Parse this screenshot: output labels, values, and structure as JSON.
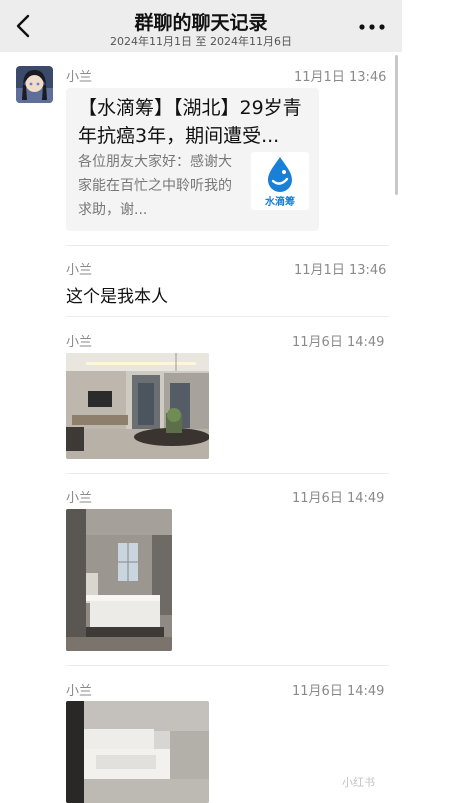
{
  "header": {
    "title": "群聊的聊天记录",
    "date_range": "2024年11月1日 至 2024年11月6日"
  },
  "messages": [
    {
      "sender": "小兰",
      "time": "11月1日 13:46",
      "card": {
        "title": "【水滴筹】【湖北】29岁青年抗癌3年，期间遭受...",
        "desc": "各位朋友大家好：感谢大家能在百忙之中聆听我的求助，谢...",
        "logo_text": "水滴筹"
      }
    },
    {
      "sender": "小兰",
      "time": "11月1日 13:46",
      "text": "这个是我本人"
    },
    {
      "sender": "小兰",
      "time": "11月6日 14:49",
      "image": "living-room-photo"
    },
    {
      "sender": "小兰",
      "time": "11月6日 14:49",
      "image": "bedroom-photo"
    },
    {
      "sender": "小兰",
      "time": "11月6日 14:49",
      "image": "bedroom-photo-2"
    }
  ],
  "watermark": "小红书",
  "colors": {
    "header_bg": "#ededed",
    "card_bg": "#f4f4f4",
    "meta_text": "#8a8a8a",
    "brand_blue": "#1a7fd6"
  }
}
